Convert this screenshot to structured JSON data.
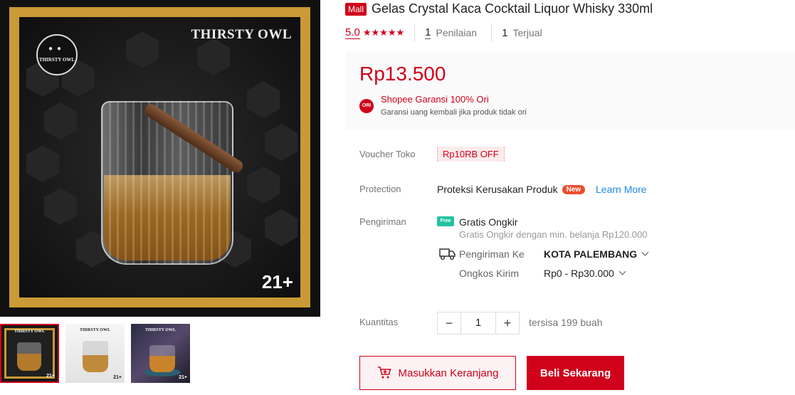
{
  "gallery": {
    "main_brand": "THIRSTY OWL",
    "logo_text": "THIRSTY OWL",
    "age_badge": "21+",
    "thumbnails": [
      {
        "brand": "THIRSTY OWL",
        "age": "21+",
        "selected": true
      },
      {
        "brand": "THIRSTY OWL",
        "age": "21+",
        "selected": false
      },
      {
        "brand": "THIRSTY OWL",
        "age": "21+",
        "selected": false
      }
    ]
  },
  "product": {
    "mall_badge": "Mall",
    "title": "Gelas Crystal Kaca Cocktail Liquor Whisky 330ml",
    "rating": "5.0",
    "stars": "★★★★★",
    "reviews_count": "1",
    "reviews_label": "Penilaian",
    "sold_count": "1",
    "sold_label": "Terjual",
    "price": "Rp13.500",
    "guarantee_icon": "ORI",
    "guarantee_title": "Shopee Garansi 100% Ori",
    "guarantee_desc": "Garansi uang kembali jika produk tidak ori"
  },
  "details": {
    "voucher_label": "Voucher Toko",
    "voucher_value": "Rp10RB OFF",
    "protection_label": "Protection",
    "protection_text": "Proteksi Kerusakan Produk",
    "new_badge": "New",
    "learn_more": "Learn More",
    "shipping_label": "Pengiriman",
    "free_icon": "Free",
    "free_title": "Gratis Ongkir",
    "free_desc": "Gratis Ongkir dengan min. belanja Rp120.000",
    "ship_to_label": "Pengiriman Ke",
    "ship_to_value": "KOTA PALEMBANG",
    "ship_cost_label": "Ongkos Kirim",
    "ship_cost_value": "Rp0 - Rp30.000",
    "quantity_label": "Kuantitas",
    "quantity_minus": "−",
    "quantity_value": "1",
    "quantity_plus": "+",
    "stock_text": "tersisa 199 buah"
  },
  "actions": {
    "add_to_cart": "Masukkan Keranjang",
    "buy_now": "Beli Sekarang"
  },
  "colors": {
    "accent": "#d0011b",
    "frame_gold": "#c99a35",
    "link_blue": "#1e88e5",
    "free_green": "#25c2a0"
  }
}
